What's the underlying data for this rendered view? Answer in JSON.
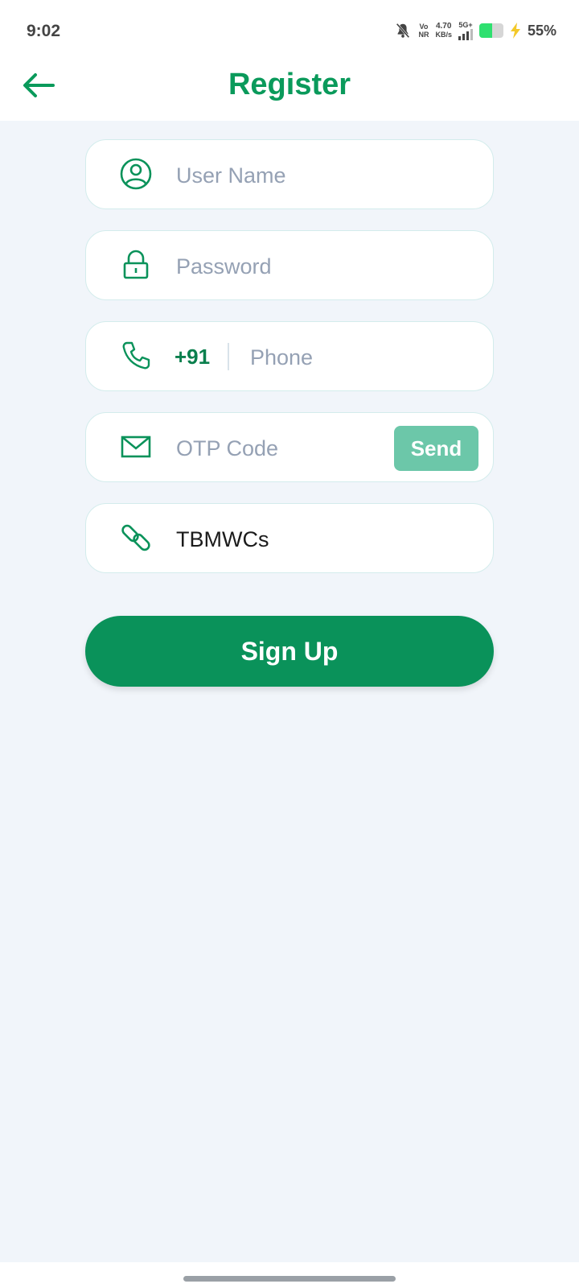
{
  "status_bar": {
    "time": "9:02",
    "vo_top": "Vo",
    "vo_bottom": "NR",
    "speed_value": "4.70",
    "speed_unit": "KB/s",
    "network": "5G+",
    "battery_percent": "55%",
    "battery_level": 0.55,
    "icons": [
      "bell-off-icon",
      "signal-icon",
      "battery-icon",
      "charging-bolt-icon"
    ]
  },
  "header": {
    "title": "Register",
    "back_icon": "arrow-left-icon"
  },
  "form": {
    "username": {
      "placeholder": "User Name",
      "value": "",
      "icon": "user-circle-icon"
    },
    "password": {
      "placeholder": "Password",
      "value": "",
      "icon": "lock-icon"
    },
    "phone": {
      "country_code": "+91",
      "placeholder": "Phone",
      "value": "",
      "icon": "phone-icon"
    },
    "otp": {
      "placeholder": "OTP Code",
      "value": "",
      "icon": "mail-icon",
      "send_label": "Send"
    },
    "invite": {
      "value": "TBMWCs",
      "icon": "link-icon"
    }
  },
  "signup_label": "Sign Up",
  "colors": {
    "primary": "#0a925a",
    "accent_light": "#6cc7a9",
    "background": "#f1f5fa",
    "placeholder": "#95a1b4"
  }
}
